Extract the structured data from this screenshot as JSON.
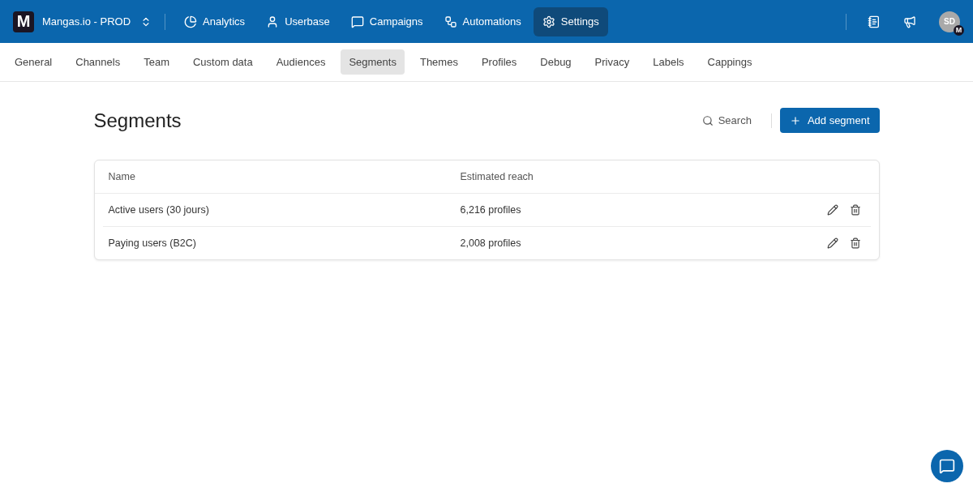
{
  "workspace": {
    "logo": "M",
    "name": "Mangas.io - PROD"
  },
  "nav": [
    {
      "label": "Analytics",
      "selected": false
    },
    {
      "label": "Userbase",
      "selected": false
    },
    {
      "label": "Campaigns",
      "selected": false
    },
    {
      "label": "Automations",
      "selected": false
    },
    {
      "label": "Settings",
      "selected": true
    }
  ],
  "user": {
    "initials": "SD",
    "badge": "M"
  },
  "tabs": [
    {
      "label": "General",
      "selected": false
    },
    {
      "label": "Channels",
      "selected": false
    },
    {
      "label": "Team",
      "selected": false
    },
    {
      "label": "Custom data",
      "selected": false
    },
    {
      "label": "Audiences",
      "selected": false
    },
    {
      "label": "Segments",
      "selected": true
    },
    {
      "label": "Themes",
      "selected": false
    },
    {
      "label": "Profiles",
      "selected": false
    },
    {
      "label": "Debug",
      "selected": false
    },
    {
      "label": "Privacy",
      "selected": false
    },
    {
      "label": "Labels",
      "selected": false
    },
    {
      "label": "Cappings",
      "selected": false
    }
  ],
  "page": {
    "title": "Segments",
    "search": "Search",
    "add_button": "Add segment"
  },
  "table": {
    "columns": [
      "Name",
      "Estimated reach"
    ],
    "rows": [
      {
        "name": "Active users (30 jours)",
        "reach": "6,216 profiles"
      },
      {
        "name": "Paying users (B2C)",
        "reach": "2,008 profiles"
      }
    ]
  }
}
